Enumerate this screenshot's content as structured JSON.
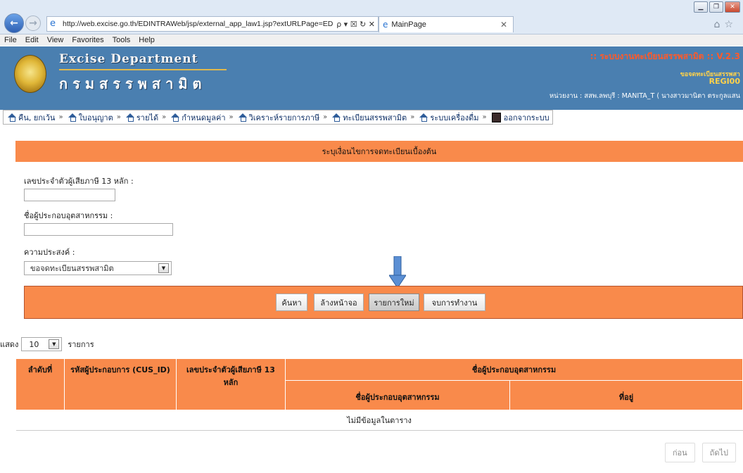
{
  "browser": {
    "url": "http://web.excise.go.th/EDINTRAWeb/jsp/external_app_law1.jsp?extURLPage=EDINTR",
    "url_controls": "ρ ▾ ☒ ↻ ✕",
    "tab_title": "MainPage",
    "menu": [
      "File",
      "Edit",
      "View",
      "Favorites",
      "Tools",
      "Help"
    ]
  },
  "header": {
    "brand_en": "Excise Department",
    "brand_th": "กรมสรรพสามิต",
    "system_title": ":: ระบบงานทะเบียนสรรพสามิต :: V.2.3",
    "system_sub": "ขอจดทะเบียนสรรพสา",
    "system_code": "REGI00",
    "user_line": "หน่วยงาน : สสพ.ลพบุรี : MANITA_T ( นางสาวมานิตา ตระกูลแสน"
  },
  "nav": {
    "items": [
      "คืน, ยกเว้น",
      "ใบอนุญาต",
      "รายได้",
      "กำหนดมูลค่า",
      "วิเคราะห์รายการภาษี",
      "ทะเบียนสรรพสามิต",
      "ระบบเครื่องดื่ม"
    ],
    "exit": "ออกจากระบบ"
  },
  "form": {
    "section_title": "ระบุเงื่อนไขการจดทะเบียนเบื้องต้น",
    "tax_id_label": "เลขประจำตัวผู้เสียภาษี 13 หลัก :",
    "tax_id_value": "",
    "operator_label": "ชื่อผู้ประกอบอุตสาหกรรม :",
    "operator_value": "",
    "purpose_label": "ความประสงค์ :",
    "purpose_value": "ขอจดทะเบียนสรรพสามิต"
  },
  "buttons": {
    "search": "ค้นหา",
    "clear": "ล้างหน้าจอ",
    "new": "รายการใหม่",
    "finish": "จบการทำงาน"
  },
  "list": {
    "show_label": "แสดง",
    "show_value": "10",
    "show_suffix": "รายการ",
    "headers": {
      "seq": "ลำดับที่",
      "cus_id": "รหัสผู้ประกอบการ (CUS_ID)",
      "tax_id": "เลขประจำตัวผู้เสียภาษี 13 หลัก",
      "operator_group": "ชื่อผู้ประกอบอุตสาหกรรม",
      "operator_name": "ชื่อผู้ประกอบอุตสาหกรรม",
      "address": "ที่อยู่"
    },
    "empty": "ไม่มีข้อมูลในตาราง",
    "prev": "ก่อน",
    "next": "ถัดไป"
  },
  "colors": {
    "accent": "#f98a4b",
    "header_blue": "#4a7fb0"
  }
}
